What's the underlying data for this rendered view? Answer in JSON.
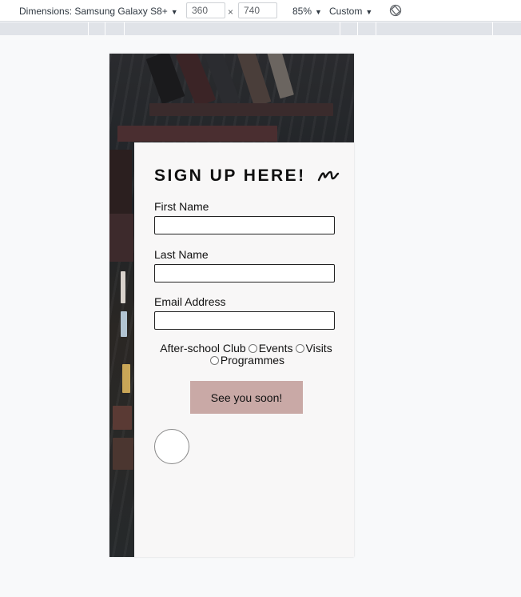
{
  "devtools": {
    "dimensions_label": "Dimensions: Samsung Galaxy S8+",
    "width_value": "360",
    "times": "×",
    "height_value": "740",
    "zoom": "85%",
    "throttle": "Custom",
    "caret": "▼"
  },
  "form": {
    "title": "SIGN UP HERE!",
    "first_name_label": "First Name",
    "last_name_label": "Last Name",
    "email_label": "Email Address",
    "first_name_value": "",
    "last_name_value": "",
    "email_value": "",
    "radio_options": [
      "After-school Club",
      "Events",
      "Visits",
      "Programmes"
    ],
    "submit_label": "See you soon!"
  },
  "colors": {
    "button": "#c9a9a6",
    "card": "#f8f7f7",
    "hero_dark": "#23272b"
  }
}
